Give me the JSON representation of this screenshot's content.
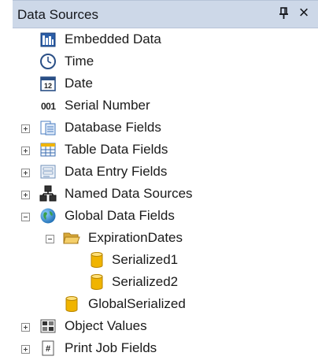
{
  "panel": {
    "title": "Data Sources",
    "pin_icon": "pin-icon",
    "close_label": "×"
  },
  "tree": {
    "embedded_data": {
      "label": "Embedded Data",
      "icon": "embedded-data-icon"
    },
    "time": {
      "label": "Time",
      "icon": "clock-icon"
    },
    "date": {
      "label": "Date",
      "icon": "calendar-icon",
      "icon_text": "12"
    },
    "serial_number": {
      "label": "Serial Number",
      "icon_text": "001"
    },
    "database_fields": {
      "label": "Database Fields",
      "icon": "database-fields-icon",
      "expanded": false
    },
    "table_data_fields": {
      "label": "Table Data Fields",
      "icon": "table-icon",
      "expanded": false
    },
    "data_entry_fields": {
      "label": "Data Entry Fields",
      "icon": "form-icon",
      "expanded": false
    },
    "named_data_sources": {
      "label": "Named Data Sources",
      "icon": "network-icon",
      "expanded": false
    },
    "global_data_fields": {
      "label": "Global Data Fields",
      "icon": "globe-icon",
      "expanded": true
    },
    "expiration_dates": {
      "label": "ExpirationDates",
      "icon": "folder-open-icon",
      "expanded": true
    },
    "serialized1": {
      "label": "Serialized1",
      "icon": "cylinder-icon"
    },
    "serialized2": {
      "label": "Serialized2",
      "icon": "cylinder-icon"
    },
    "global_serialized": {
      "label": "GlobalSerialized",
      "icon": "cylinder-icon"
    },
    "object_values": {
      "label": "Object Values",
      "icon": "object-values-icon",
      "expanded": false
    },
    "print_job_fields": {
      "label": "Print Job Fields",
      "icon": "print-job-icon",
      "expanded": false
    }
  },
  "colors": {
    "titlebar": "#cdd8e8",
    "cylinder": "#f0b400",
    "globe": "#1f7ec4",
    "folder": "#e8c25a"
  }
}
